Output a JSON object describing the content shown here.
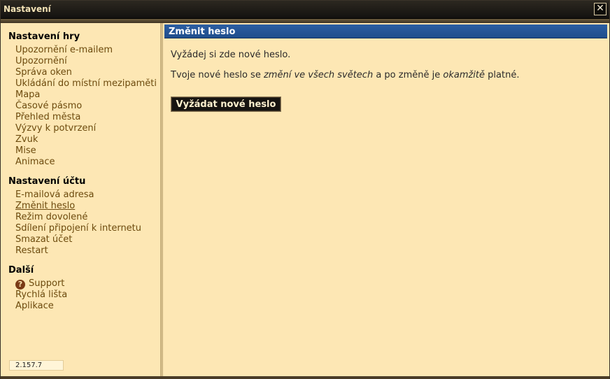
{
  "window": {
    "title": "Nastavení",
    "close_label": "✕"
  },
  "sidebar": {
    "sections": [
      {
        "title": "Nastavení hry",
        "items": [
          "Upozornění e-mailem",
          "Upozornění",
          "Správa oken",
          "Ukládání do místní mezipaměti",
          "Mapa",
          "Časové pásmo",
          "Přehled města",
          "Výzvy k potvrzení",
          "Zvuk",
          "Mise",
          "Animace"
        ]
      },
      {
        "title": "Nastavení účtu",
        "items": [
          "E-mailová adresa",
          "Změnit heslo",
          "Režim dovolené",
          "Sdílení připojení k internetu",
          "Smazat účet",
          "Restart"
        ]
      },
      {
        "title": "Další",
        "items": [
          "Support",
          "Rychlá lišta",
          "Aplikace"
        ]
      }
    ],
    "active_item": "Změnit heslo",
    "version": "2.157.7"
  },
  "content": {
    "header": "Změnit heslo",
    "line1": "Vyžádej si zde nové heslo.",
    "line2": {
      "t1": "Tvoje nové heslo se ",
      "em1": "změní ve všech světech",
      "t2": " a po změně je ",
      "em2": "okamžitě",
      "t3": " platné."
    },
    "button_label": "Vyžádat nové heslo"
  },
  "icons": {
    "support": "question-circle-icon",
    "close": "close-icon"
  }
}
